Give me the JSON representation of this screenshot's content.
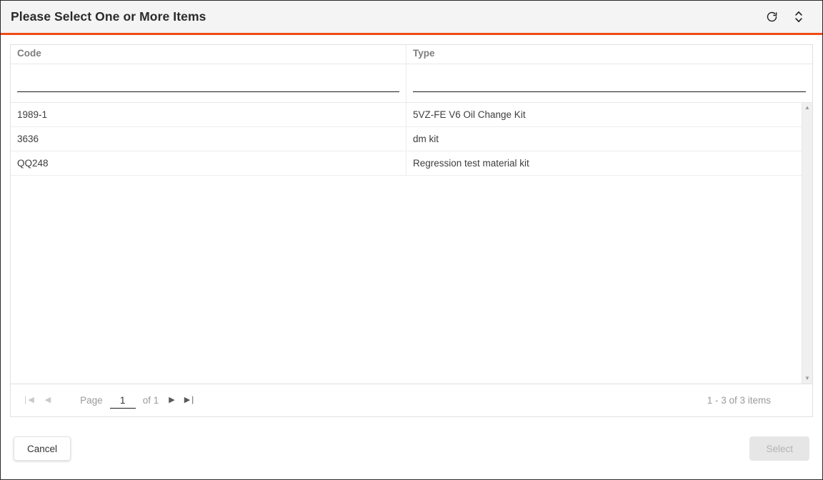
{
  "dialog": {
    "title": "Please Select One or More Items",
    "accent_color": "#ef4c16",
    "titlebar_bg": "#f4f4f4"
  },
  "title_actions": [
    {
      "name": "refresh-icon",
      "label": "Refresh"
    },
    {
      "name": "expand-collapse-icon",
      "label": "Expand or collapse"
    }
  ],
  "grid": {
    "columns": [
      {
        "key": "code",
        "header": "Code",
        "filter_value": "",
        "filter_placeholder": ""
      },
      {
        "key": "type",
        "header": "Type",
        "filter_value": "",
        "filter_placeholder": ""
      }
    ],
    "rows": [
      {
        "code": "1989-1",
        "type": "5VZ-FE V6 Oil Change Kit"
      },
      {
        "code": "3636",
        "type": "dm kit"
      },
      {
        "code": "QQ248",
        "type": "Regression test material kit"
      }
    ]
  },
  "pager": {
    "first_icon": "❘◀",
    "prev_icon": "◀",
    "next_icon": "▶",
    "last_icon": "▶❘",
    "page_label": "Page",
    "page_value": "1",
    "of_label": "of 1",
    "count_text": "1 - 3 of 3 items"
  },
  "scrollbar": {
    "up_icon": "▲",
    "down_icon": "▼"
  },
  "footer": {
    "cancel_label": "Cancel",
    "select_label": "Select"
  }
}
